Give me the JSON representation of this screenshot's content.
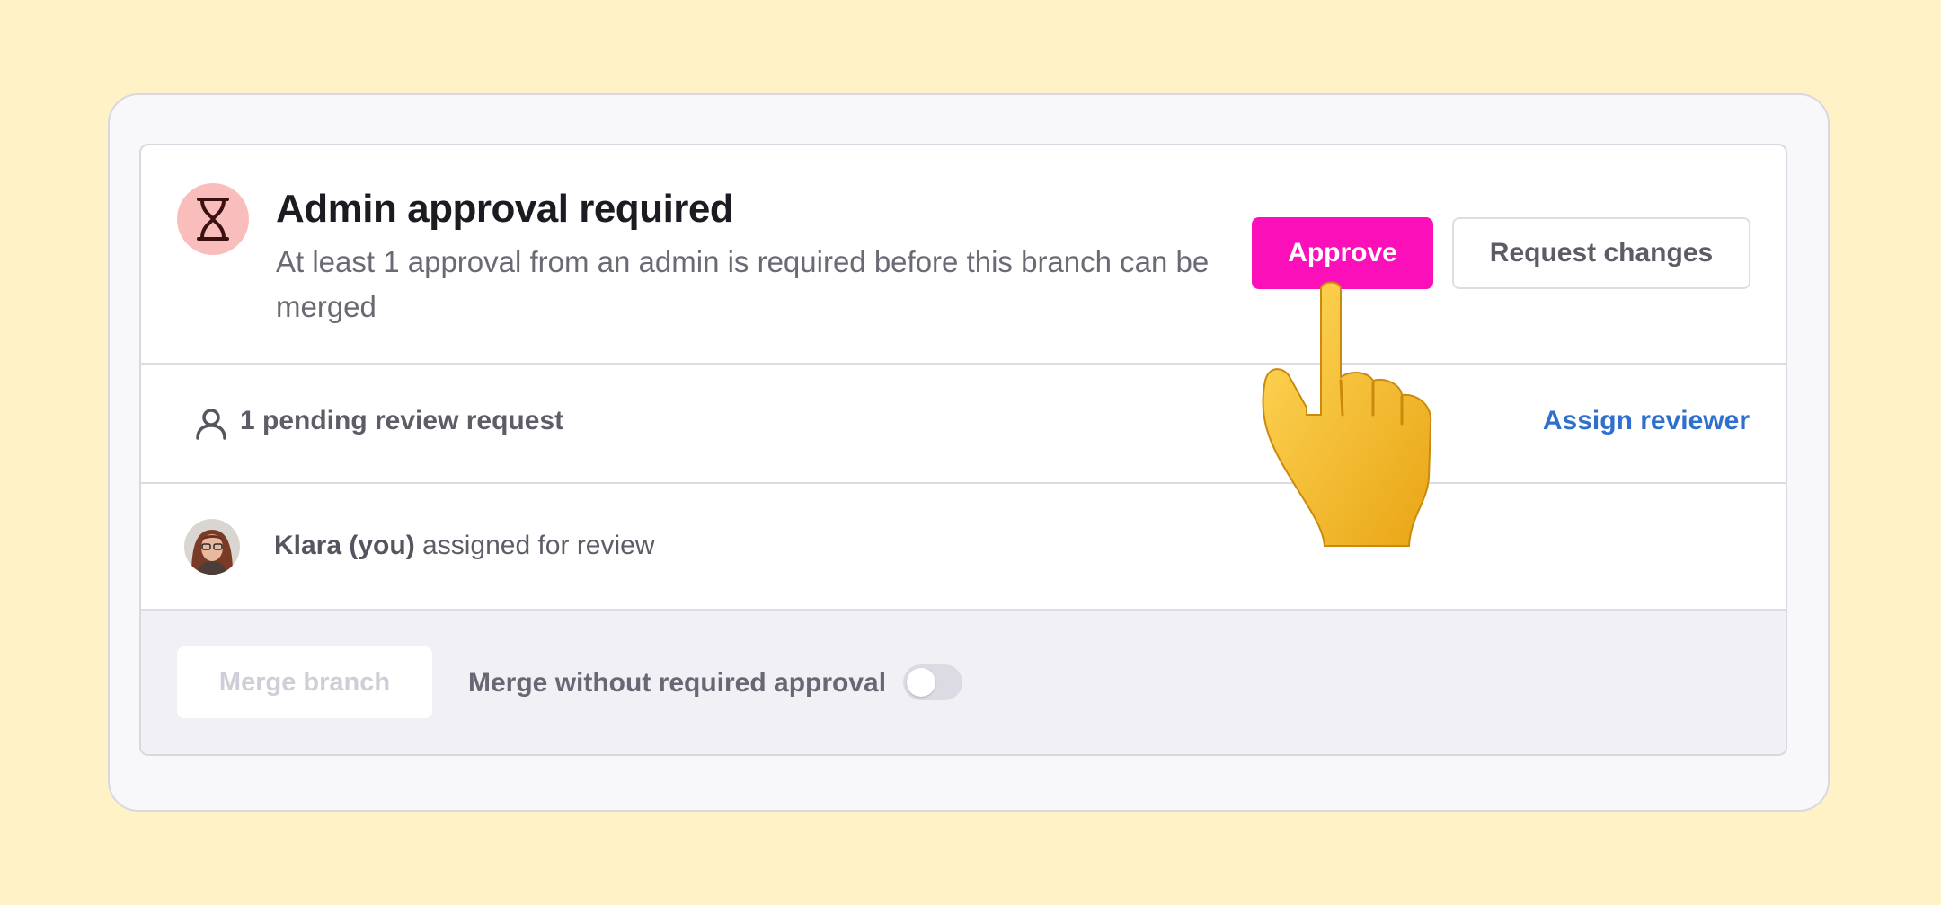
{
  "header": {
    "title": "Admin approval required",
    "subtitle": "At least 1 approval from an admin is required before this branch can be merged",
    "status_icon": "hourglass-icon",
    "approve_label": "Approve",
    "request_changes_label": "Request changes"
  },
  "pending": {
    "icon": "person-icon",
    "text": "1 pending review request",
    "assign_label": "Assign reviewer"
  },
  "reviewer": {
    "name": "Klara (you)",
    "status": "assigned for review"
  },
  "merge": {
    "button_label": "Merge branch",
    "bypass_label": "Merge without required approval",
    "bypass_enabled": false
  },
  "pointer": "pointing-hand-icon",
  "colors": {
    "background": "#fef2c6",
    "approve": "#fb0fb8",
    "status_icon_bg": "#f9bdbb",
    "link": "#2f6fce"
  }
}
